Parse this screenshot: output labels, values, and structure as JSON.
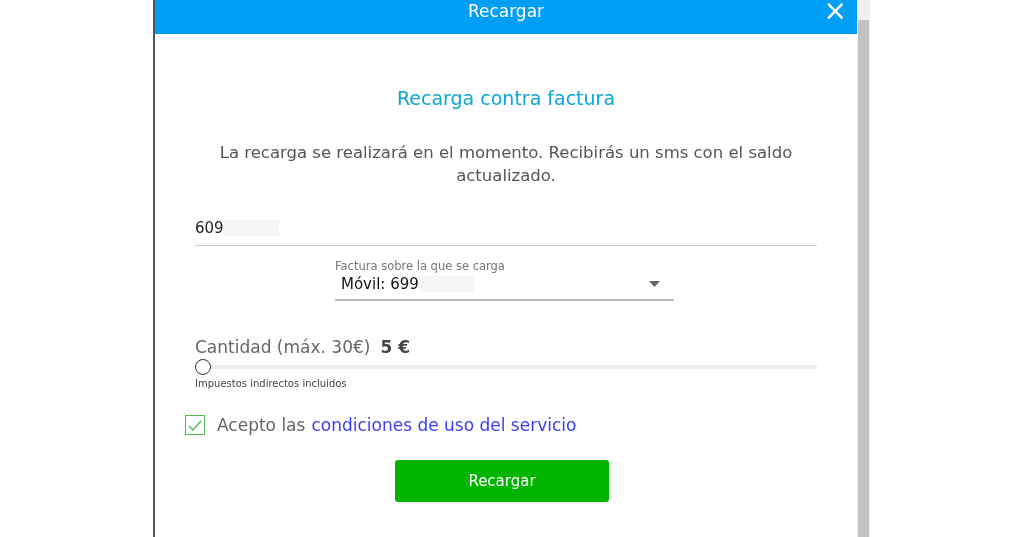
{
  "dialog": {
    "title": "Recargar",
    "close": "×"
  },
  "heading": "Recarga contra factura",
  "description": "La recarga se realizará en el momento. Recibirás un sms con el saldo actualizado.",
  "phone": {
    "value": "609"
  },
  "invoice_select": {
    "label": "Factura sobre la que se carga",
    "value": "Móvil: 699"
  },
  "amount": {
    "label": "Cantidad (máx. 30€)",
    "value": "5 €",
    "level": 0,
    "note": "Impuestos indirectos incluidos"
  },
  "terms": {
    "checked": true,
    "text": "Acepto las",
    "link": "condiciones de uso del servicio"
  },
  "submit": "Recargar"
}
